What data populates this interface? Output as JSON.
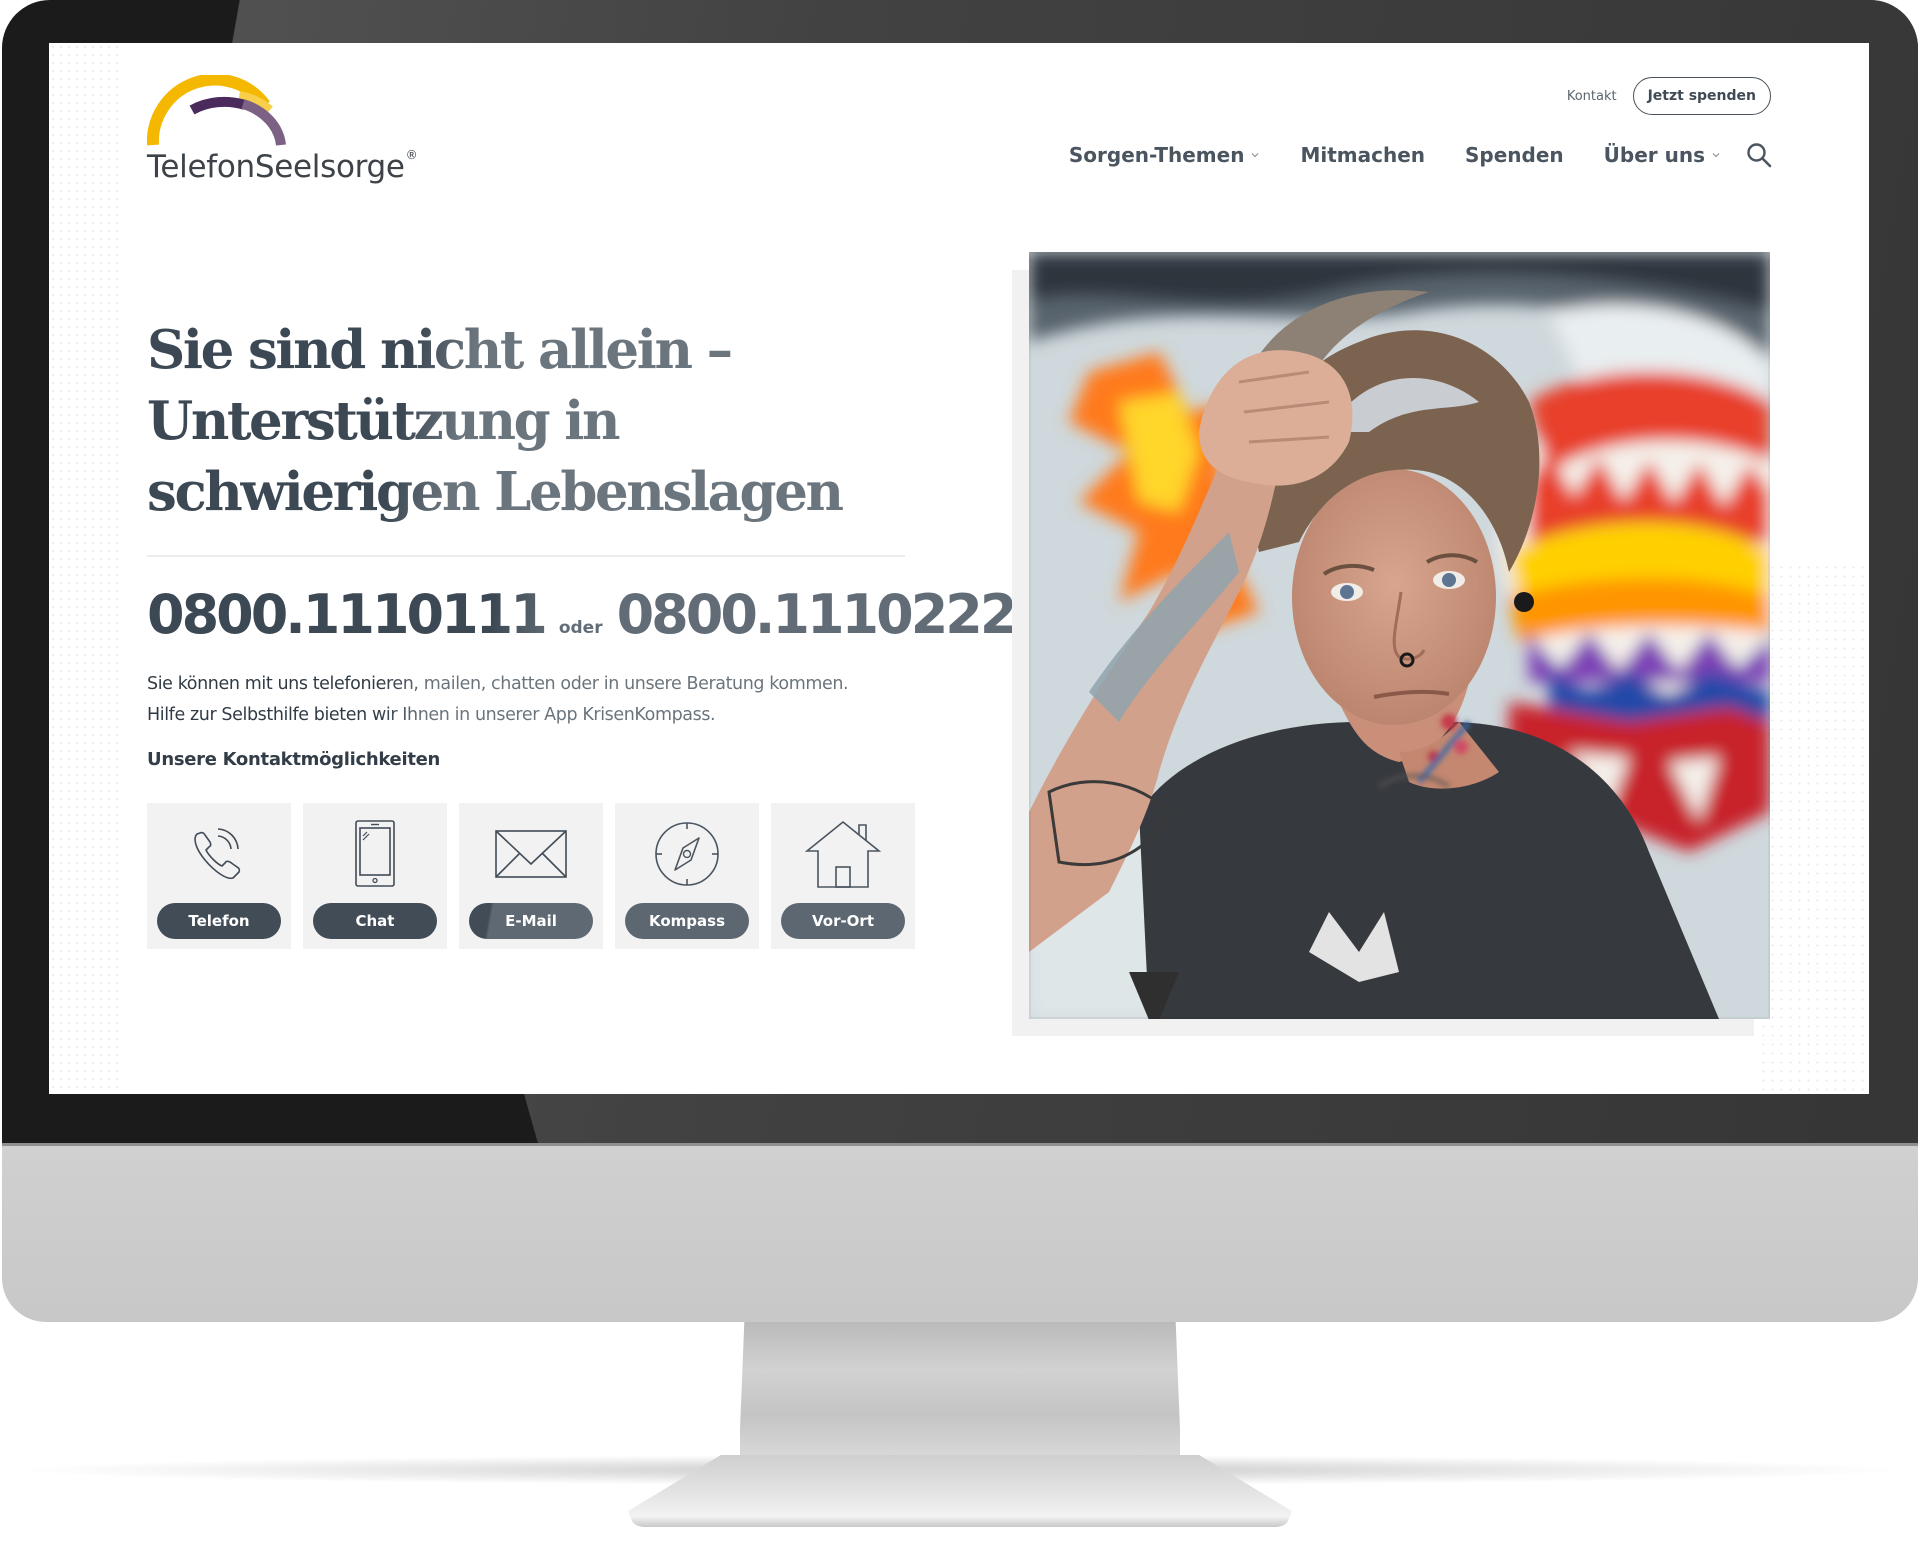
{
  "site": {
    "logo_text": "TelefonSeelsorge",
    "logo_mark": "®",
    "brand_colors": {
      "yellow": "#f5b800",
      "purple": "#4b2a5c",
      "text": "#3d4349"
    }
  },
  "utility_nav": {
    "contact_label": "Kontakt",
    "donate_button_label": "Jetzt spenden"
  },
  "main_nav": {
    "items": [
      {
        "label": "Sorgen-Themen",
        "has_dropdown": true
      },
      {
        "label": "Mitmachen",
        "has_dropdown": false
      },
      {
        "label": "Spenden",
        "has_dropdown": false
      },
      {
        "label": "Über uns",
        "has_dropdown": true
      }
    ],
    "search_icon": "search-icon"
  },
  "hero": {
    "title_lines": [
      "Sie sind nicht allein –",
      "Unterstützung in",
      "schwierigen Lebenslagen"
    ],
    "phone_primary": "0800.1110111",
    "phone_separator": "oder",
    "phone_secondary": "0800.1110222",
    "description_lines": [
      "Sie können mit uns telefonieren, mailen, chatten oder in unsere Beratung kommen.",
      "Hilfe zur Selbsthilfe bieten wir Ihnen in unserer App KrisenKompass."
    ],
    "contact_heading": "Unsere Kontaktmöglichkeiten",
    "contact_options": [
      {
        "label": "Telefon",
        "icon": "phone-icon"
      },
      {
        "label": "Chat",
        "icon": "smartphone-icon"
      },
      {
        "label": "E-Mail",
        "icon": "envelope-icon"
      },
      {
        "label": "Kompass",
        "icon": "compass-icon"
      },
      {
        "label": "Vor-Ort",
        "icon": "house-icon"
      }
    ],
    "image_alt": "Person mit Tattoos greift sich vor buntem Wandbild in die Haare"
  }
}
